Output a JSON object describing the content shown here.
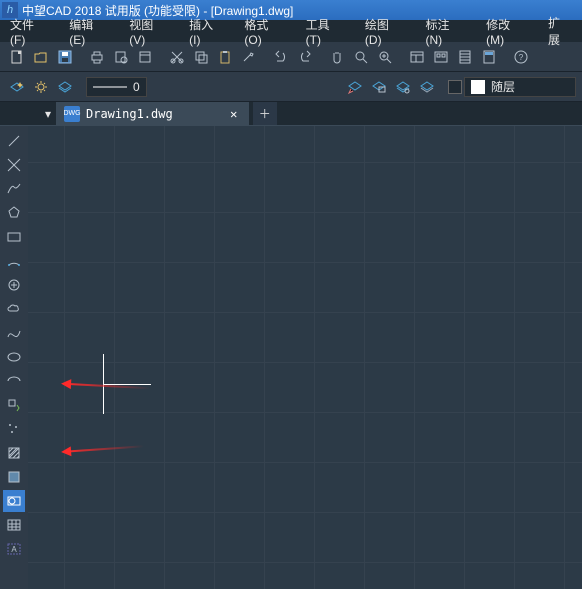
{
  "titlebar": {
    "text": "中望CAD 2018 试用版 (功能受限) - [Drawing1.dwg]"
  },
  "menu": [
    "文件(F)",
    "编辑(E)",
    "视图(V)",
    "插入(I)",
    "格式(O)",
    "工具(T)",
    "绘图(D)",
    "标注(N)",
    "修改(M)",
    "扩展"
  ],
  "doc": {
    "name": "Drawing1.dwg"
  },
  "lineweight": {
    "value": "0"
  },
  "layer": {
    "label": "随层"
  },
  "left_tools": [
    "line",
    "polyline",
    "arc",
    "polygon",
    "rectangle",
    "arc2",
    "circle-target",
    "revision-cloud",
    "spline",
    "circle",
    "arc3",
    "text",
    "point",
    "hatch",
    "bar",
    "region",
    "table",
    "dim"
  ]
}
